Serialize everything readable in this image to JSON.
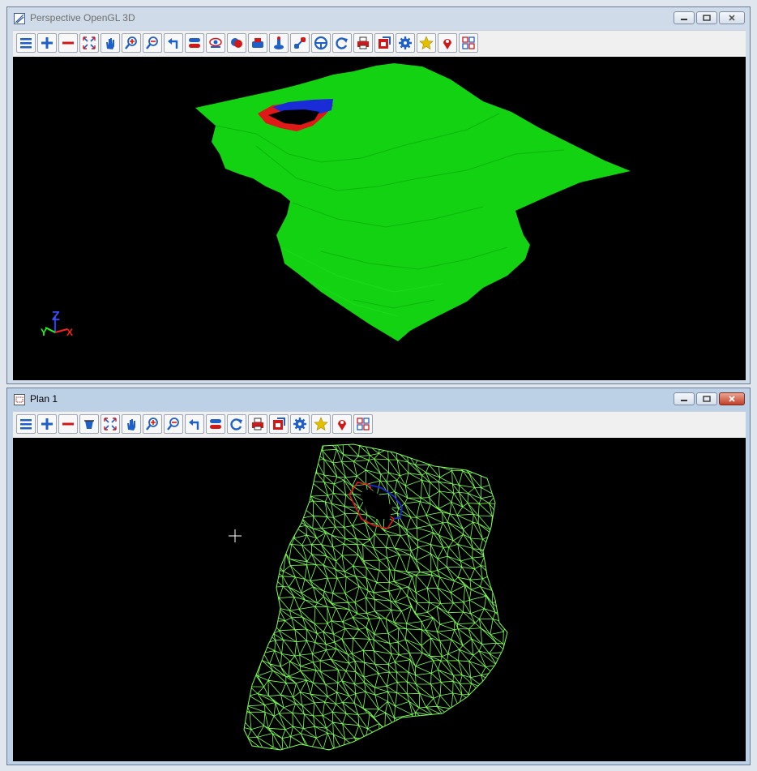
{
  "windows": {
    "perspective": {
      "title": "Perspective OpenGL 3D"
    },
    "plan": {
      "title": "Plan 1"
    }
  },
  "axis_labels": {
    "z": "Z",
    "y": "Y",
    "x": "X"
  },
  "colors": {
    "terrain": "#10d010",
    "mesh": "#7dff57",
    "hole_red": "#e01818",
    "hole_blue": "#1a2bd8",
    "titlebar_active": "#bcd0e6",
    "titlebar_inactive": "#cfdbe8"
  },
  "toolbar_perspective_icons": [
    "menu-icon",
    "zoom-in-plus-icon",
    "zoom-out-minus-icon",
    "fit-extents-icon",
    "pan-hand-icon",
    "zoom-magnify-plus-icon",
    "zoom-magnify-minus-icon",
    "previous-view-icon",
    "toggle-icon",
    "eye-icon",
    "shading-icon",
    "render-icon",
    "light-icon",
    "view-icon",
    "steering-icon",
    "refresh-icon",
    "print-icon",
    "export-icon",
    "settings-gear-icon",
    "favorite-star-icon",
    "location-pin-icon",
    "grid-icon"
  ],
  "toolbar_plan_icons": [
    "menu-icon",
    "zoom-in-plus-icon",
    "zoom-out-minus-icon",
    "bucket-icon",
    "fit-extents-icon",
    "pan-hand-icon",
    "zoom-magnify-plus-icon",
    "zoom-magnify-minus-icon",
    "previous-view-icon",
    "toggle-icon",
    "refresh-icon",
    "print-icon",
    "export-icon",
    "settings-gear-icon",
    "favorite-star-icon",
    "location-pin-icon",
    "grid-icon"
  ]
}
